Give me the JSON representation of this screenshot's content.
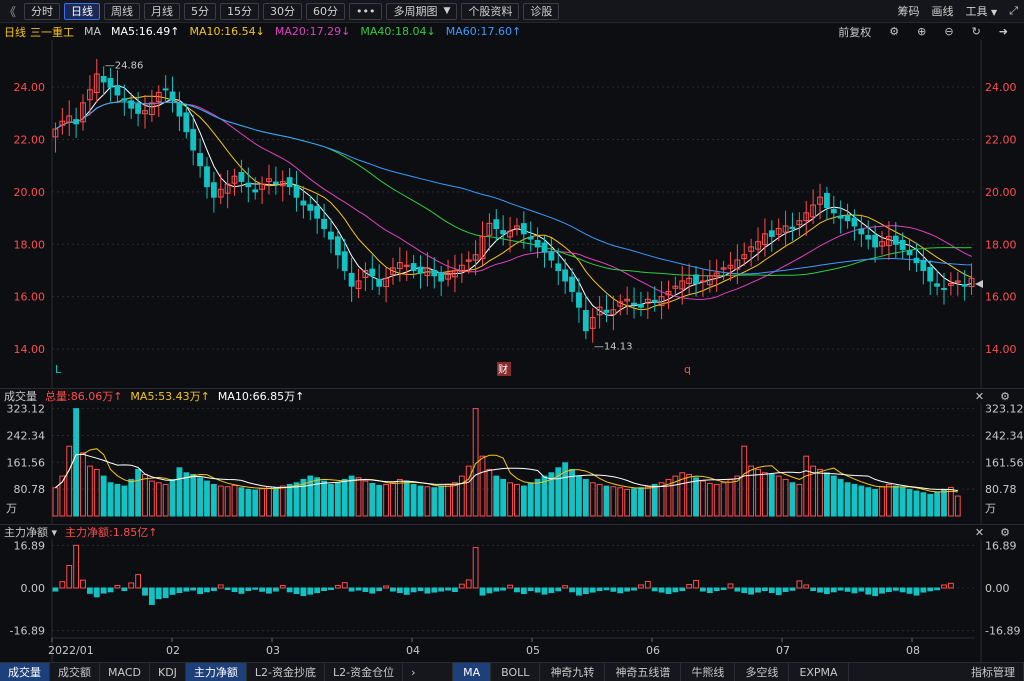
{
  "toolbar": {
    "nav_left": "《",
    "periods": [
      {
        "label": "分时",
        "active": false
      },
      {
        "label": "日线",
        "active": true
      },
      {
        "label": "周线",
        "active": false
      },
      {
        "label": "月线",
        "active": false
      },
      {
        "label": "5分",
        "active": false
      },
      {
        "label": "15分",
        "active": false
      },
      {
        "label": "30分",
        "active": false
      },
      {
        "label": "60分",
        "active": false
      }
    ],
    "more": "•••",
    "multi_period": "多周期图",
    "profile": "个股资料",
    "diagnose": "诊股",
    "right": {
      "chips": "筹码",
      "draw": "画线",
      "tools": "工具"
    }
  },
  "indicator_bar": {
    "period": "日线",
    "stock_name": "三一重工",
    "ma_label": "MA",
    "ma5": "MA5:16.49↑",
    "ma10": "MA10:16.54↓",
    "ma20": "MA20:17.29↓",
    "ma40": "MA40:18.04↓",
    "ma60": "MA60:17.60↑",
    "adjust": "前复权"
  },
  "colors": {
    "up": "#ff4d4d",
    "down": "#13c2c2",
    "ma5": "#ffffff",
    "ma10": "#f5c518",
    "ma20": "#e040c0",
    "ma40": "#2ecc40",
    "ma60": "#3a9bff",
    "bg": "#0d0e12",
    "grid": "#2a2c33"
  },
  "volume_bar": {
    "title": "成交量",
    "total": "总量:86.06万↑",
    "ma5": "MA5:53.43万↑",
    "ma10": "MA10:66.85万↑",
    "unit": "万"
  },
  "capital_bar": {
    "title": "主力净额 ▾",
    "value": "主力净额:1.85亿↑"
  },
  "bottom_tabs": {
    "left": [
      {
        "label": "成交量",
        "active": true
      },
      {
        "label": "成交额",
        "active": false
      },
      {
        "label": "MACD",
        "active": false
      },
      {
        "label": "KDJ",
        "active": false
      },
      {
        "label": "主力净额",
        "active": true
      },
      {
        "label": "L2-资金抄底",
        "active": false
      },
      {
        "label": "L2-资金仓位",
        "active": false
      }
    ],
    "more": "›",
    "right": [
      {
        "label": "MA",
        "active": true
      },
      {
        "label": "BOLL",
        "active": false
      },
      {
        "label": "神奇九转",
        "active": false
      },
      {
        "label": "神奇五线谱",
        "active": false
      },
      {
        "label": "牛熊线",
        "active": false
      },
      {
        "label": "多空线",
        "active": false
      },
      {
        "label": "EXPMA",
        "active": false
      }
    ],
    "manage": "指标管理"
  },
  "markers": {
    "L": "L",
    "cai": "财",
    "q": "q"
  },
  "chart_data": {
    "type": "candlestick",
    "price_axis": {
      "ticks": [
        "24.00",
        "22.00",
        "20.00",
        "18.00",
        "16.00",
        "14.00"
      ],
      "ylim": [
        13.2,
        25.8
      ]
    },
    "high_label": "24.86",
    "low_label": "14.13",
    "x_ticks": [
      "2022/01",
      "02",
      "03",
      "04",
      "05",
      "06",
      "07",
      "08"
    ],
    "volume_axis": {
      "ticks": [
        "323.12",
        "242.34",
        "161.56",
        "80.78"
      ],
      "unit": "万",
      "ylim": [
        0,
        340
      ]
    },
    "capital_axis": {
      "ticks": [
        "16.89",
        "0.00",
        "-16.89"
      ],
      "ylim": [
        -19,
        19
      ]
    },
    "closes": [
      22.4,
      22.7,
      22.9,
      22.6,
      23.4,
      23.9,
      24.5,
      24.2,
      24.0,
      23.7,
      23.5,
      23.2,
      23.0,
      23.1,
      23.4,
      23.8,
      23.9,
      23.5,
      22.9,
      22.3,
      21.6,
      21.0,
      20.2,
      19.8,
      20.1,
      20.3,
      20.6,
      20.4,
      20.2,
      20.0,
      20.3,
      20.5,
      20.3,
      20.4,
      20.2,
      19.8,
      19.5,
      19.3,
      19.0,
      18.6,
      18.2,
      17.6,
      17.0,
      16.4,
      16.6,
      17.0,
      16.8,
      16.4,
      16.7,
      17.1,
      17.3,
      17.2,
      17.0,
      16.9,
      17.1,
      16.8,
      16.6,
      16.9,
      17.0,
      17.2,
      17.4,
      17.6,
      18.3,
      18.8,
      18.6,
      18.4,
      18.5,
      18.7,
      18.4,
      18.2,
      17.9,
      17.7,
      17.4,
      17.0,
      16.6,
      16.2,
      15.6,
      14.7,
      15.2,
      15.6,
      15.4,
      15.5,
      15.8,
      15.9,
      15.7,
      15.6,
      15.9,
      15.8,
      16.0,
      16.2,
      16.4,
      16.6,
      16.7,
      16.5,
      16.6,
      16.8,
      16.9,
      17.1,
      17.2,
      17.4,
      17.6,
      17.9,
      18.1,
      18.4,
      18.3,
      18.6,
      18.7,
      18.6,
      18.9,
      19.2,
      19.5,
      19.8,
      19.4,
      19.2,
      19.0,
      18.9,
      18.7,
      18.4,
      18.2,
      17.9,
      18.1,
      18.3,
      18.0,
      17.8,
      17.6,
      17.3,
      17.0,
      16.6,
      16.4,
      16.3,
      16.5,
      16.6,
      16.4,
      16.7
    ],
    "volumes": [
      85,
      120,
      210,
      323,
      190,
      150,
      140,
      120,
      100,
      95,
      90,
      110,
      140,
      125,
      105,
      100,
      95,
      110,
      145,
      130,
      125,
      115,
      105,
      95,
      90,
      88,
      92,
      85,
      80,
      78,
      82,
      88,
      85,
      90,
      95,
      100,
      110,
      120,
      115,
      105,
      95,
      100,
      110,
      120,
      115,
      105,
      98,
      92,
      95,
      100,
      110,
      105,
      95,
      90,
      88,
      85,
      90,
      95,
      100,
      120,
      150,
      323,
      180,
      140,
      120,
      110,
      100,
      95,
      90,
      100,
      110,
      120,
      130,
      145,
      160,
      140,
      120,
      110,
      100,
      95,
      90,
      88,
      85,
      80,
      82,
      85,
      88,
      95,
      100,
      110,
      120,
      130,
      125,
      115,
      105,
      98,
      95,
      100,
      110,
      120,
      210,
      150,
      140,
      130,
      125,
      120,
      110,
      100,
      95,
      180,
      150,
      140,
      130,
      120,
      110,
      100,
      95,
      90,
      85,
      80,
      88,
      95,
      90,
      85,
      80,
      75,
      70,
      65,
      72,
      80,
      86,
      60
    ],
    "capital": [
      -1.2,
      2.5,
      8.9,
      16.89,
      3.1,
      -2.1,
      -3.5,
      -2.0,
      -1.5,
      1.0,
      -1.0,
      2.0,
      5.3,
      -2.8,
      -6.5,
      -4.2,
      -3.8,
      -2.5,
      -1.8,
      -1.2,
      -0.8,
      -2.2,
      -1.5,
      -1.0,
      1.2,
      -0.6,
      -1.4,
      -2.1,
      -1.0,
      -0.5,
      -1.3,
      -2.0,
      -1.2,
      1.0,
      -1.5,
      -2.2,
      -3.0,
      -2.4,
      -1.8,
      -1.0,
      -0.6,
      1.0,
      2.1,
      -1.2,
      -0.8,
      -1.4,
      -2.0,
      -1.0,
      0.8,
      -1.2,
      -1.8,
      -2.5,
      -1.5,
      -1.0,
      -2.0,
      -1.6,
      -1.2,
      -0.8,
      -1.4,
      1.5,
      3.2,
      16.0,
      -2.8,
      -1.9,
      -1.2,
      -0.8,
      1.1,
      -1.5,
      -2.2,
      -1.0,
      -1.6,
      -2.4,
      -1.8,
      -1.1,
      0.9,
      -1.5,
      -2.8,
      -2.2,
      -1.6,
      -1.0,
      -0.7,
      -1.3,
      -1.9,
      -1.2,
      -0.8,
      1.2,
      2.6,
      -1.1,
      -1.6,
      -2.2,
      -1.5,
      -1.0,
      1.4,
      3.0,
      -1.2,
      -1.8,
      -1.0,
      -0.6,
      1.6,
      -1.2,
      -1.8,
      -2.4,
      -1.6,
      -1.0,
      -1.8,
      -2.6,
      -1.4,
      -0.9,
      2.8,
      1.2,
      -1.0,
      -1.6,
      -2.2,
      -1.5,
      -0.8,
      -1.3,
      -1.9,
      -1.2,
      -2.4,
      -3.0,
      -2.0,
      -1.4,
      -0.9,
      -1.5,
      -2.1,
      -2.8,
      -1.6,
      -1.1,
      -0.7,
      1.2,
      1.85
    ]
  }
}
